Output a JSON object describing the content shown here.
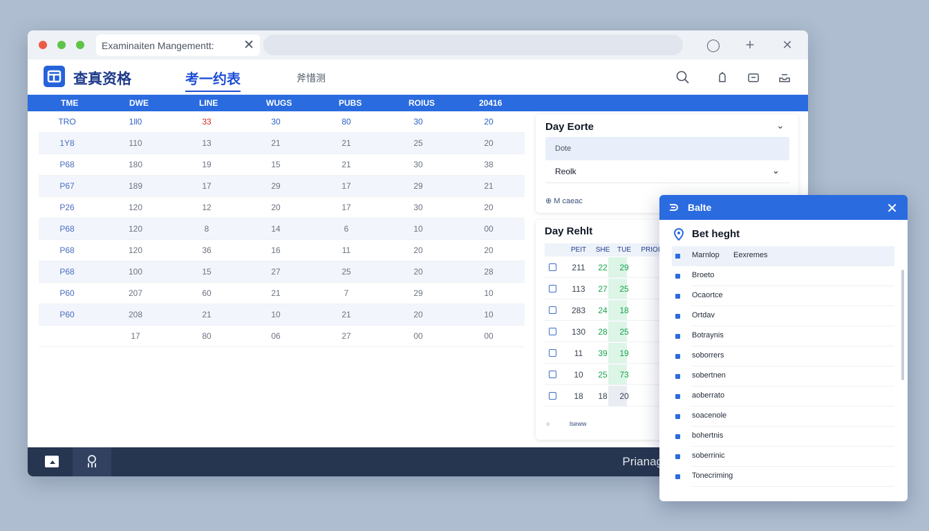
{
  "browser": {
    "tab_title": "Examinaiten Mangementt:",
    "tab_close": "✕",
    "btn_circle": "◯",
    "btn_plus": "+",
    "btn_close": "✕"
  },
  "app": {
    "brand": "查真资格",
    "nav_active": "考一约表",
    "nav_other": "斧惜测"
  },
  "grid": {
    "headers": [
      "TME",
      "DWE",
      "LINE",
      "WUGS",
      "PUBS",
      "ROIUS",
      "20416"
    ],
    "rows": [
      [
        "TRO",
        "1ll0",
        "33",
        "30",
        "80",
        "30",
        "20"
      ],
      [
        "1Y8",
        "110",
        "13",
        "21",
        "21",
        "25",
        "20"
      ],
      [
        "P68",
        "180",
        "19",
        "15",
        "21",
        "30",
        "38"
      ],
      [
        "P67",
        "189",
        "17",
        "29",
        "17",
        "29",
        "21"
      ],
      [
        "P26",
        "120",
        "12",
        "20",
        "17",
        "30",
        "20"
      ],
      [
        "P68",
        "120",
        "8",
        "14",
        "6",
        "10",
        "00"
      ],
      [
        "P68",
        "120",
        "36",
        "16",
        "11",
        "20",
        "20"
      ],
      [
        "P68",
        "100",
        "15",
        "27",
        "25",
        "20",
        "28"
      ],
      [
        "P60",
        "207",
        "60",
        "21",
        "7",
        "29",
        "10"
      ],
      [
        "P60",
        "208",
        "21",
        "10",
        "21",
        "20",
        "10"
      ],
      [
        "",
        "17",
        "80",
        "06",
        "27",
        "00",
        "00"
      ]
    ]
  },
  "day_editor": {
    "title": "Day Eorte",
    "chevron": "⌄",
    "field_a": "Dote",
    "field_b": "Reolk",
    "field_b_chevron": "⌄",
    "link_icon": "⊕",
    "link": "M caeac"
  },
  "day_result": {
    "title": "Day Rehlt",
    "headers": [
      "PEIT",
      "SHE",
      "TUE",
      "PRIOI"
    ],
    "rows": [
      [
        "211",
        "22",
        "29"
      ],
      [
        "113",
        "27",
        "25"
      ],
      [
        "283",
        "24",
        "18"
      ],
      [
        "130",
        "28",
        "25"
      ],
      [
        "11",
        "39",
        "19"
      ],
      [
        "10",
        "25",
        "73"
      ],
      [
        "18",
        "18",
        "20"
      ]
    ],
    "foot_icon": "○",
    "foot": "lseww"
  },
  "bottombar": {
    "text": "Prianag"
  },
  "panel": {
    "title": "Balte",
    "close": "✕",
    "subtitle": "Bet heght",
    "items": [
      {
        "label": "Marnlop",
        "extra": "Eexremes"
      },
      {
        "label": "Broeto"
      },
      {
        "label": "Ocaortce"
      },
      {
        "label": "Ortdav"
      },
      {
        "label": "Botraynis"
      },
      {
        "label": "soborrers"
      },
      {
        "label": "sobertnen"
      },
      {
        "label": "aoberrato"
      },
      {
        "label": "soacenole"
      },
      {
        "label": "bohertnis"
      },
      {
        "label": "soberrinic"
      },
      {
        "label": "Tonecriming"
      }
    ]
  },
  "colors": {
    "accent": "#2a6be0",
    "bottombar": "#263550",
    "highlight_green": "#dcf5e6",
    "alert_red": "#dc2626"
  }
}
